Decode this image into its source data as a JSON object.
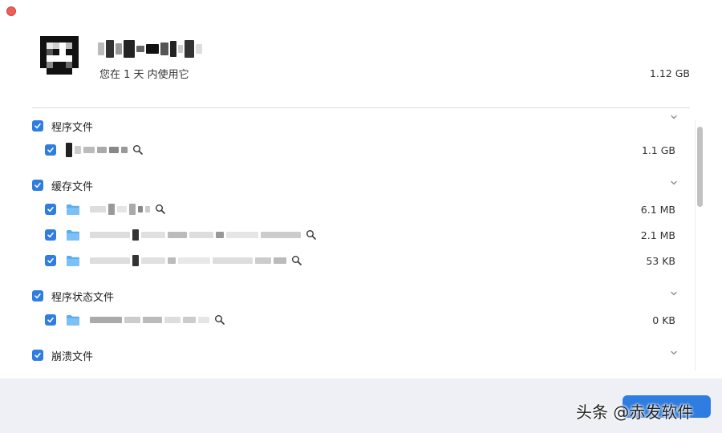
{
  "header": {
    "usage_text": "您在 1 天 内使用它",
    "total_size": "1.12 GB"
  },
  "groups": [
    {
      "label": "程序文件",
      "checked": true,
      "items": [
        {
          "size": "1.1 GB",
          "checked": true
        }
      ]
    },
    {
      "label": "缓存文件",
      "checked": true,
      "items": [
        {
          "size": "6.1 MB",
          "checked": true
        },
        {
          "size": "2.1 MB",
          "checked": true
        },
        {
          "size": "53 KB",
          "checked": true
        }
      ]
    },
    {
      "label": "程序状态文件",
      "checked": true,
      "items": [
        {
          "size": "0 KB",
          "checked": true
        }
      ]
    },
    {
      "label": "崩溃文件",
      "checked": true,
      "items": []
    }
  ],
  "watermark": "头条 @赤发软件",
  "icons": {
    "close": "close-dot-icon",
    "checkbox": "checkbox-checked-icon",
    "folder": "folder-icon",
    "search": "magnifier-icon",
    "chevron": "chevron-down-icon"
  },
  "colors": {
    "accent": "#2f7de1",
    "close": "#ec5f57",
    "footer": "#eff0f5"
  }
}
